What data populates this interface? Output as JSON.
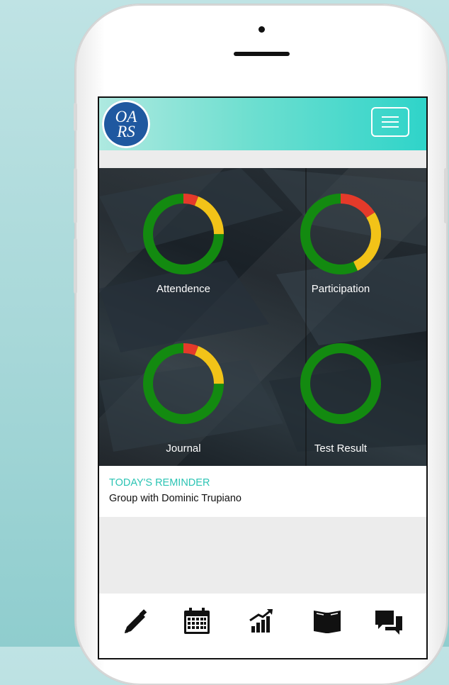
{
  "header": {
    "logo_text": "OA\nRS",
    "menu_icon": "hamburger-menu-icon"
  },
  "dashboard": {
    "metrics": [
      {
        "label": "Attendence",
        "segments": {
          "green": 0.75,
          "yellow": 0.19,
          "red": 0.06
        }
      },
      {
        "label": "Participation",
        "segments": {
          "green": 0.57,
          "yellow": 0.27,
          "red": 0.16
        }
      },
      {
        "label": "Journal",
        "segments": {
          "green": 0.75,
          "yellow": 0.19,
          "red": 0.06
        }
      },
      {
        "label": "Test Result",
        "segments": {
          "green": 1.0,
          "yellow": 0.0,
          "red": 0.0
        }
      }
    ],
    "colors": {
      "green": "#138a10",
      "yellow": "#f2c318",
      "red": "#e53a2a"
    }
  },
  "reminder": {
    "title": "TODAY'S REMINDER",
    "text": "Group with Dominic Trupiano"
  },
  "tabbar": {
    "icons": [
      "pencil-icon",
      "calendar-icon",
      "chart-icon",
      "book-icon",
      "chat-icon"
    ]
  }
}
